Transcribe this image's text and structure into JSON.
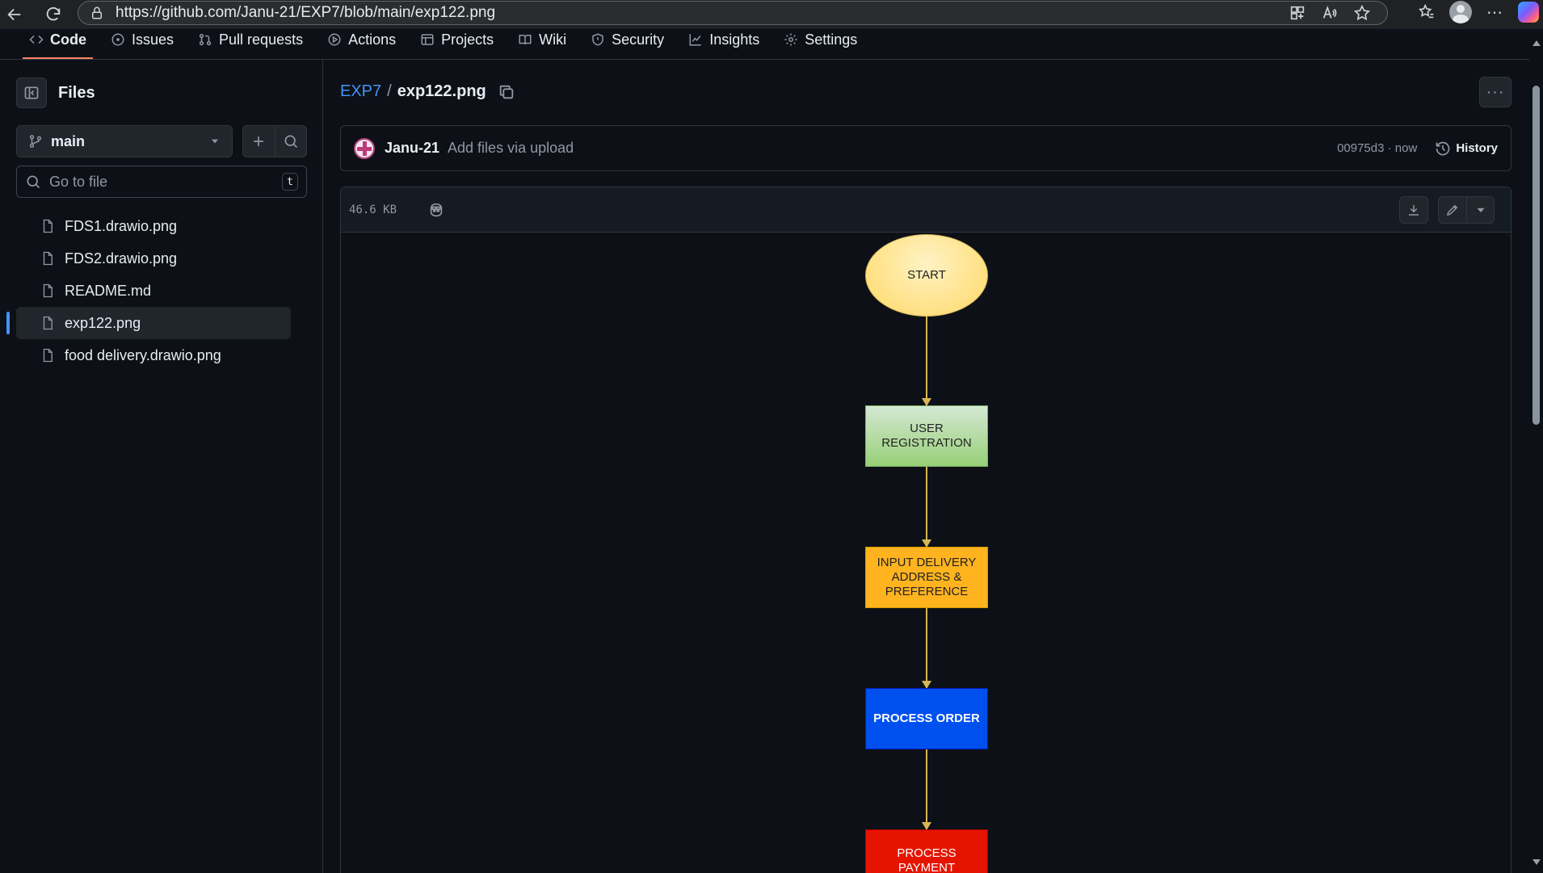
{
  "browser": {
    "url": "https://github.com/Janu-21/EXP7/blob/main/exp122.png"
  },
  "repo_nav": {
    "tabs": [
      {
        "label": "Code",
        "icon": "code-icon",
        "active": true
      },
      {
        "label": "Issues",
        "icon": "issue-icon"
      },
      {
        "label": "Pull requests",
        "icon": "pull-request-icon"
      },
      {
        "label": "Actions",
        "icon": "play-icon"
      },
      {
        "label": "Projects",
        "icon": "table-icon"
      },
      {
        "label": "Wiki",
        "icon": "book-icon"
      },
      {
        "label": "Security",
        "icon": "shield-icon"
      },
      {
        "label": "Insights",
        "icon": "graph-icon"
      },
      {
        "label": "Settings",
        "icon": "gear-icon"
      }
    ]
  },
  "sidebar": {
    "title": "Files",
    "branch": "main",
    "search_placeholder": "Go to file",
    "search_shortcut": "t",
    "files": [
      {
        "name": "FDS1.drawio.png"
      },
      {
        "name": "FDS2.drawio.png"
      },
      {
        "name": "README.md"
      },
      {
        "name": "exp122.png",
        "selected": true
      },
      {
        "name": "food delivery.drawio.png"
      }
    ]
  },
  "breadcrumb": {
    "repo": "EXP7",
    "separator": "/",
    "file": "exp122.png"
  },
  "commit": {
    "author": "Janu-21",
    "message": "Add files via upload",
    "meta": "00975d3 · now",
    "history_label": "History"
  },
  "viewer": {
    "size": "46.6 KB"
  },
  "flowchart": {
    "nodes": {
      "start": "START",
      "registration": "USER REGISTRATION",
      "address": "INPUT DELIVERY ADDRESS & PREFERENCE",
      "process_order": "PROCESS ORDER",
      "payment": "PROCESS PAYMENT"
    }
  },
  "colors": {
    "accent_blue": "#4493f8",
    "active_tab_underline": "#f78166",
    "start_fill": "#ffd966",
    "registration_fill": "#97d077",
    "address_fill": "#ffb31f",
    "process_order_fill": "#0050ef",
    "payment_fill": "#e51400"
  }
}
